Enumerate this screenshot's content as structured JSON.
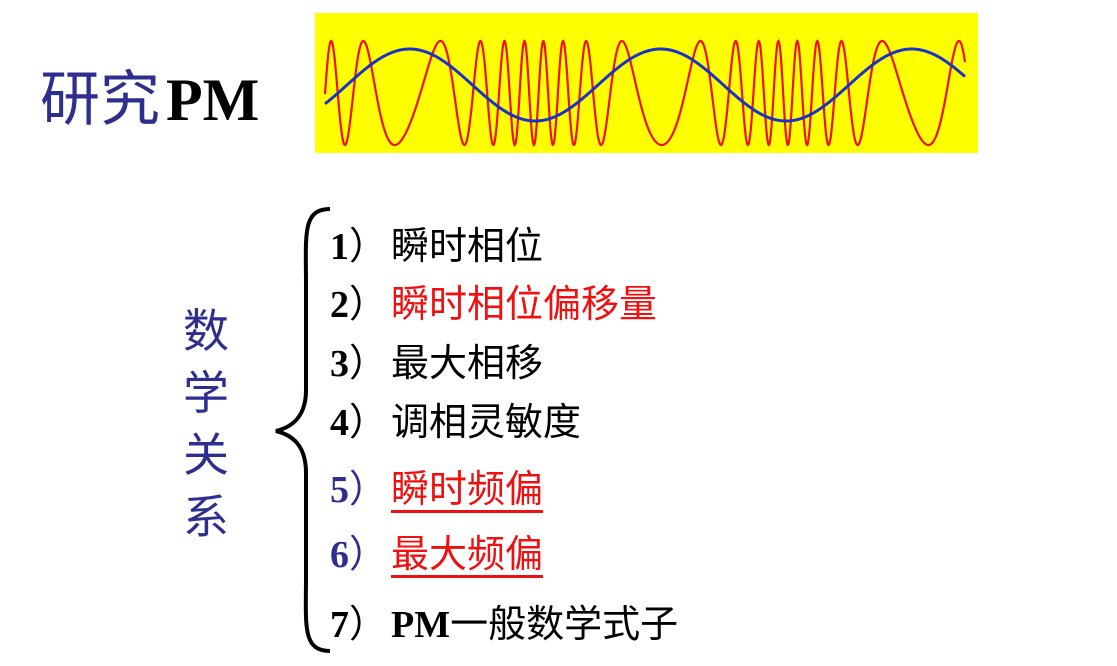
{
  "title": {
    "prefix": "研究",
    "suffix": "PM"
  },
  "side_label": [
    "数",
    "学",
    "关",
    "系"
  ],
  "colors": {
    "title_blue": "#2e2e8f",
    "highlight_yellow": "#ffff00",
    "carrier_red": "#ee1111",
    "modulating_blue": "#1a33c8",
    "black": "#000000",
    "red": "#ee1111",
    "blue": "#2e2e8f"
  },
  "items": [
    {
      "num": "1",
      "sep": "）",
      "text": "瞬时相位",
      "num_color": "black",
      "text_color": "black",
      "underline": false
    },
    {
      "num": "2",
      "sep": "）",
      "text": "瞬时相位偏移量",
      "num_color": "black",
      "text_color": "red",
      "underline": false
    },
    {
      "num": "3",
      "sep": "）",
      "text": "最大相移",
      "num_color": "black",
      "text_color": "black",
      "underline": false
    },
    {
      "num": "4",
      "sep": "）",
      "text": "调相灵敏度",
      "num_color": "black",
      "text_color": "black",
      "underline": false
    },
    {
      "num": "5",
      "sep": "）",
      "text": "瞬时频偏",
      "num_color": "blue",
      "text_color": "red",
      "underline": true
    },
    {
      "num": "6",
      "sep": "）",
      "text": "最大频偏",
      "num_color": "blue",
      "text_color": "red",
      "underline": true
    },
    {
      "num": "7",
      "sep": "）",
      "text_latin": "PM",
      "text": "一般数学式子",
      "num_color": "black",
      "text_color": "black",
      "underline": false
    }
  ]
}
